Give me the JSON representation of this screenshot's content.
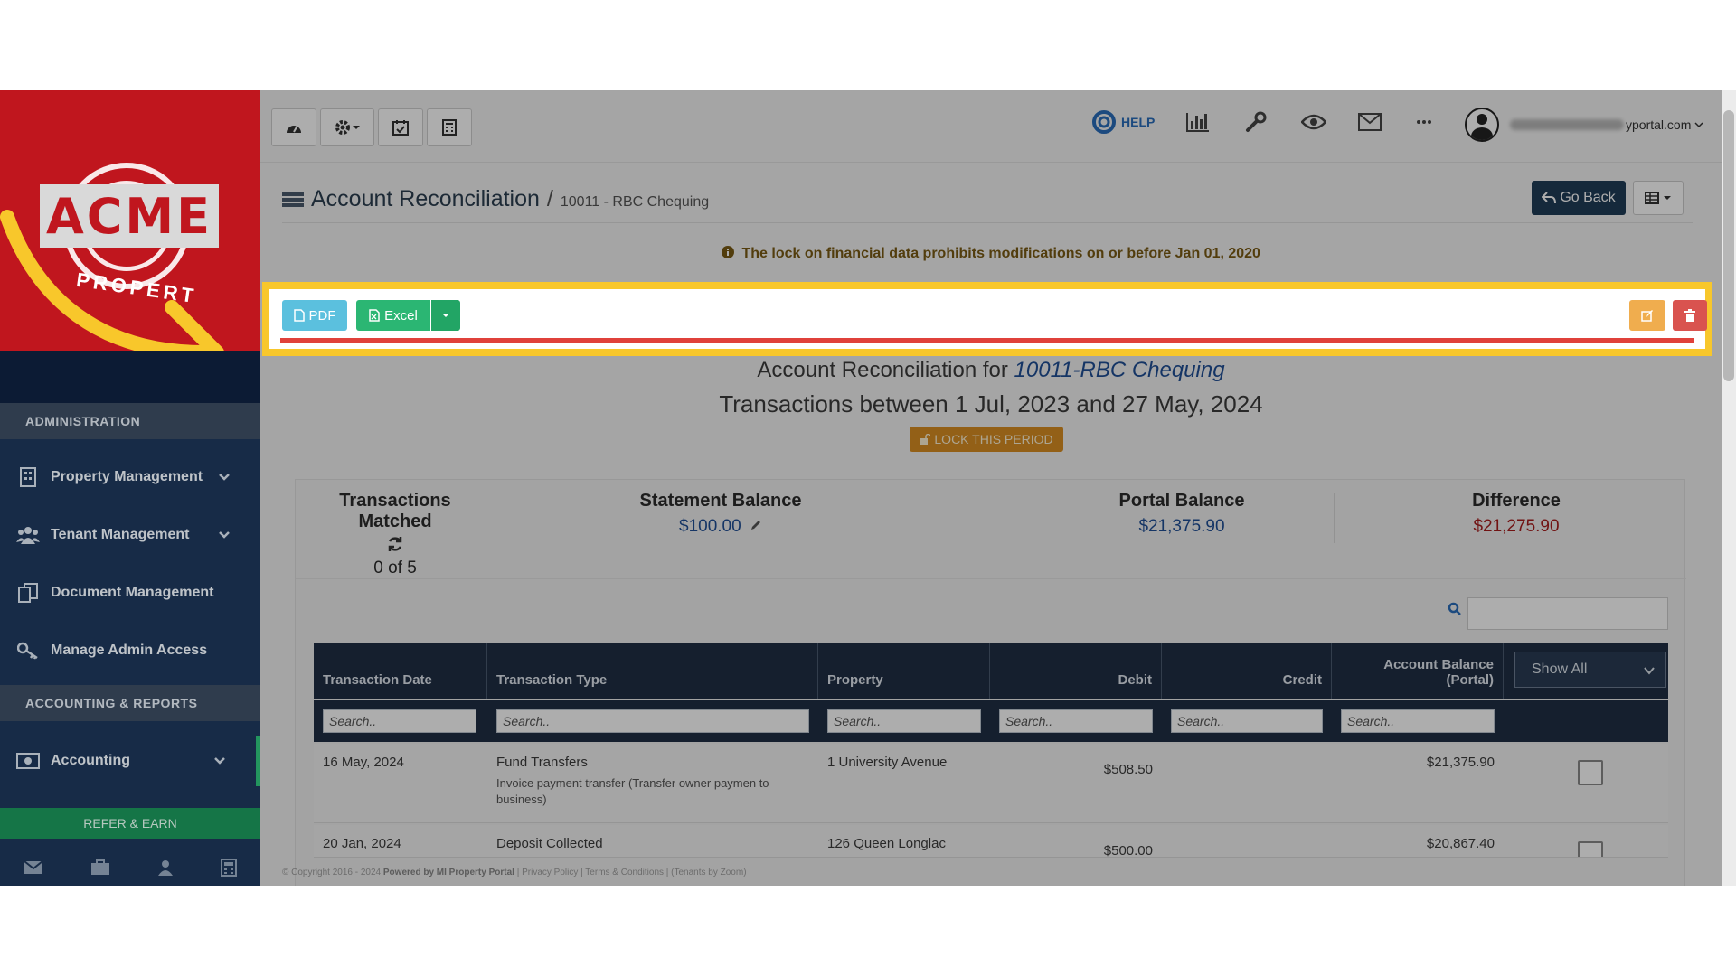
{
  "sidebar": {
    "logo_text": "ACME",
    "logo_sub": "PROPERT",
    "section_admin": "ADMINISTRATION",
    "items": [
      {
        "label": "Property Management"
      },
      {
        "label": "Tenant Management"
      },
      {
        "label": "Document Management"
      },
      {
        "label": "Manage Admin Access"
      }
    ],
    "section_accounting": "ACCOUNTING & REPORTS",
    "accounting_label": "Accounting",
    "refer_label": "REFER & EARN"
  },
  "topbar": {
    "help_label": "HELP",
    "user_suffix": "yportal.com"
  },
  "page": {
    "title": "Account Reconciliation",
    "separator": "/",
    "subtitle": "10011 - RBC Chequing",
    "go_back": "Go Back",
    "lock_note": "The lock on financial data prohibits modifications on or before Jan 01, 2020"
  },
  "actions": {
    "pdf": "PDF",
    "excel": "Excel"
  },
  "report": {
    "title_prefix": "Account Reconciliation for",
    "title_account": "10011-RBC Chequing",
    "subtitle": "Transactions between 1 Jul, 2023 and 27 May, 2024",
    "lock_period": "LOCK THIS PERIOD"
  },
  "summary": {
    "matched_label": "Transactions Matched",
    "matched_value": "0 of 5",
    "statement_label": "Statement Balance",
    "statement_value": "$100.00",
    "portal_label": "Portal Balance",
    "portal_value": "$21,375.90",
    "difference_label": "Difference",
    "difference_value": "$21,275.90"
  },
  "table": {
    "headers": {
      "date": "Transaction Date",
      "type": "Transaction Type",
      "property": "Property",
      "debit": "Debit",
      "credit": "Credit",
      "balance_line1": "Account Balance",
      "balance_line2": "(Portal)"
    },
    "filter_label": "Show All",
    "search_placeholder": "Search..",
    "rows": [
      {
        "date": "16 May, 2024",
        "type": "Fund Transfers",
        "note": "Invoice payment transfer (Transfer owner paymen to business)",
        "property": "1 University Avenue",
        "debit": "$508.50",
        "credit": "",
        "balance": "$21,375.90"
      },
      {
        "date": "20 Jan, 2024",
        "type": "Deposit Collected",
        "note": "",
        "property": "126 Queen Longlac",
        "debit": "$500.00",
        "credit": "",
        "balance": "$20,867.40"
      }
    ]
  },
  "footer": {
    "copyright": "© Copyright 2016 - 2024",
    "powered": "Powered by MI Property Portal",
    "links": "| Privacy Policy | Terms & Conditions | (Tenants by Zoom)"
  },
  "colors": {
    "highlight": "#f8c72b",
    "pdf": "#5bc0de",
    "excel": "#2bb673",
    "edit": "#f0ad4e",
    "delete": "#d9534f"
  }
}
